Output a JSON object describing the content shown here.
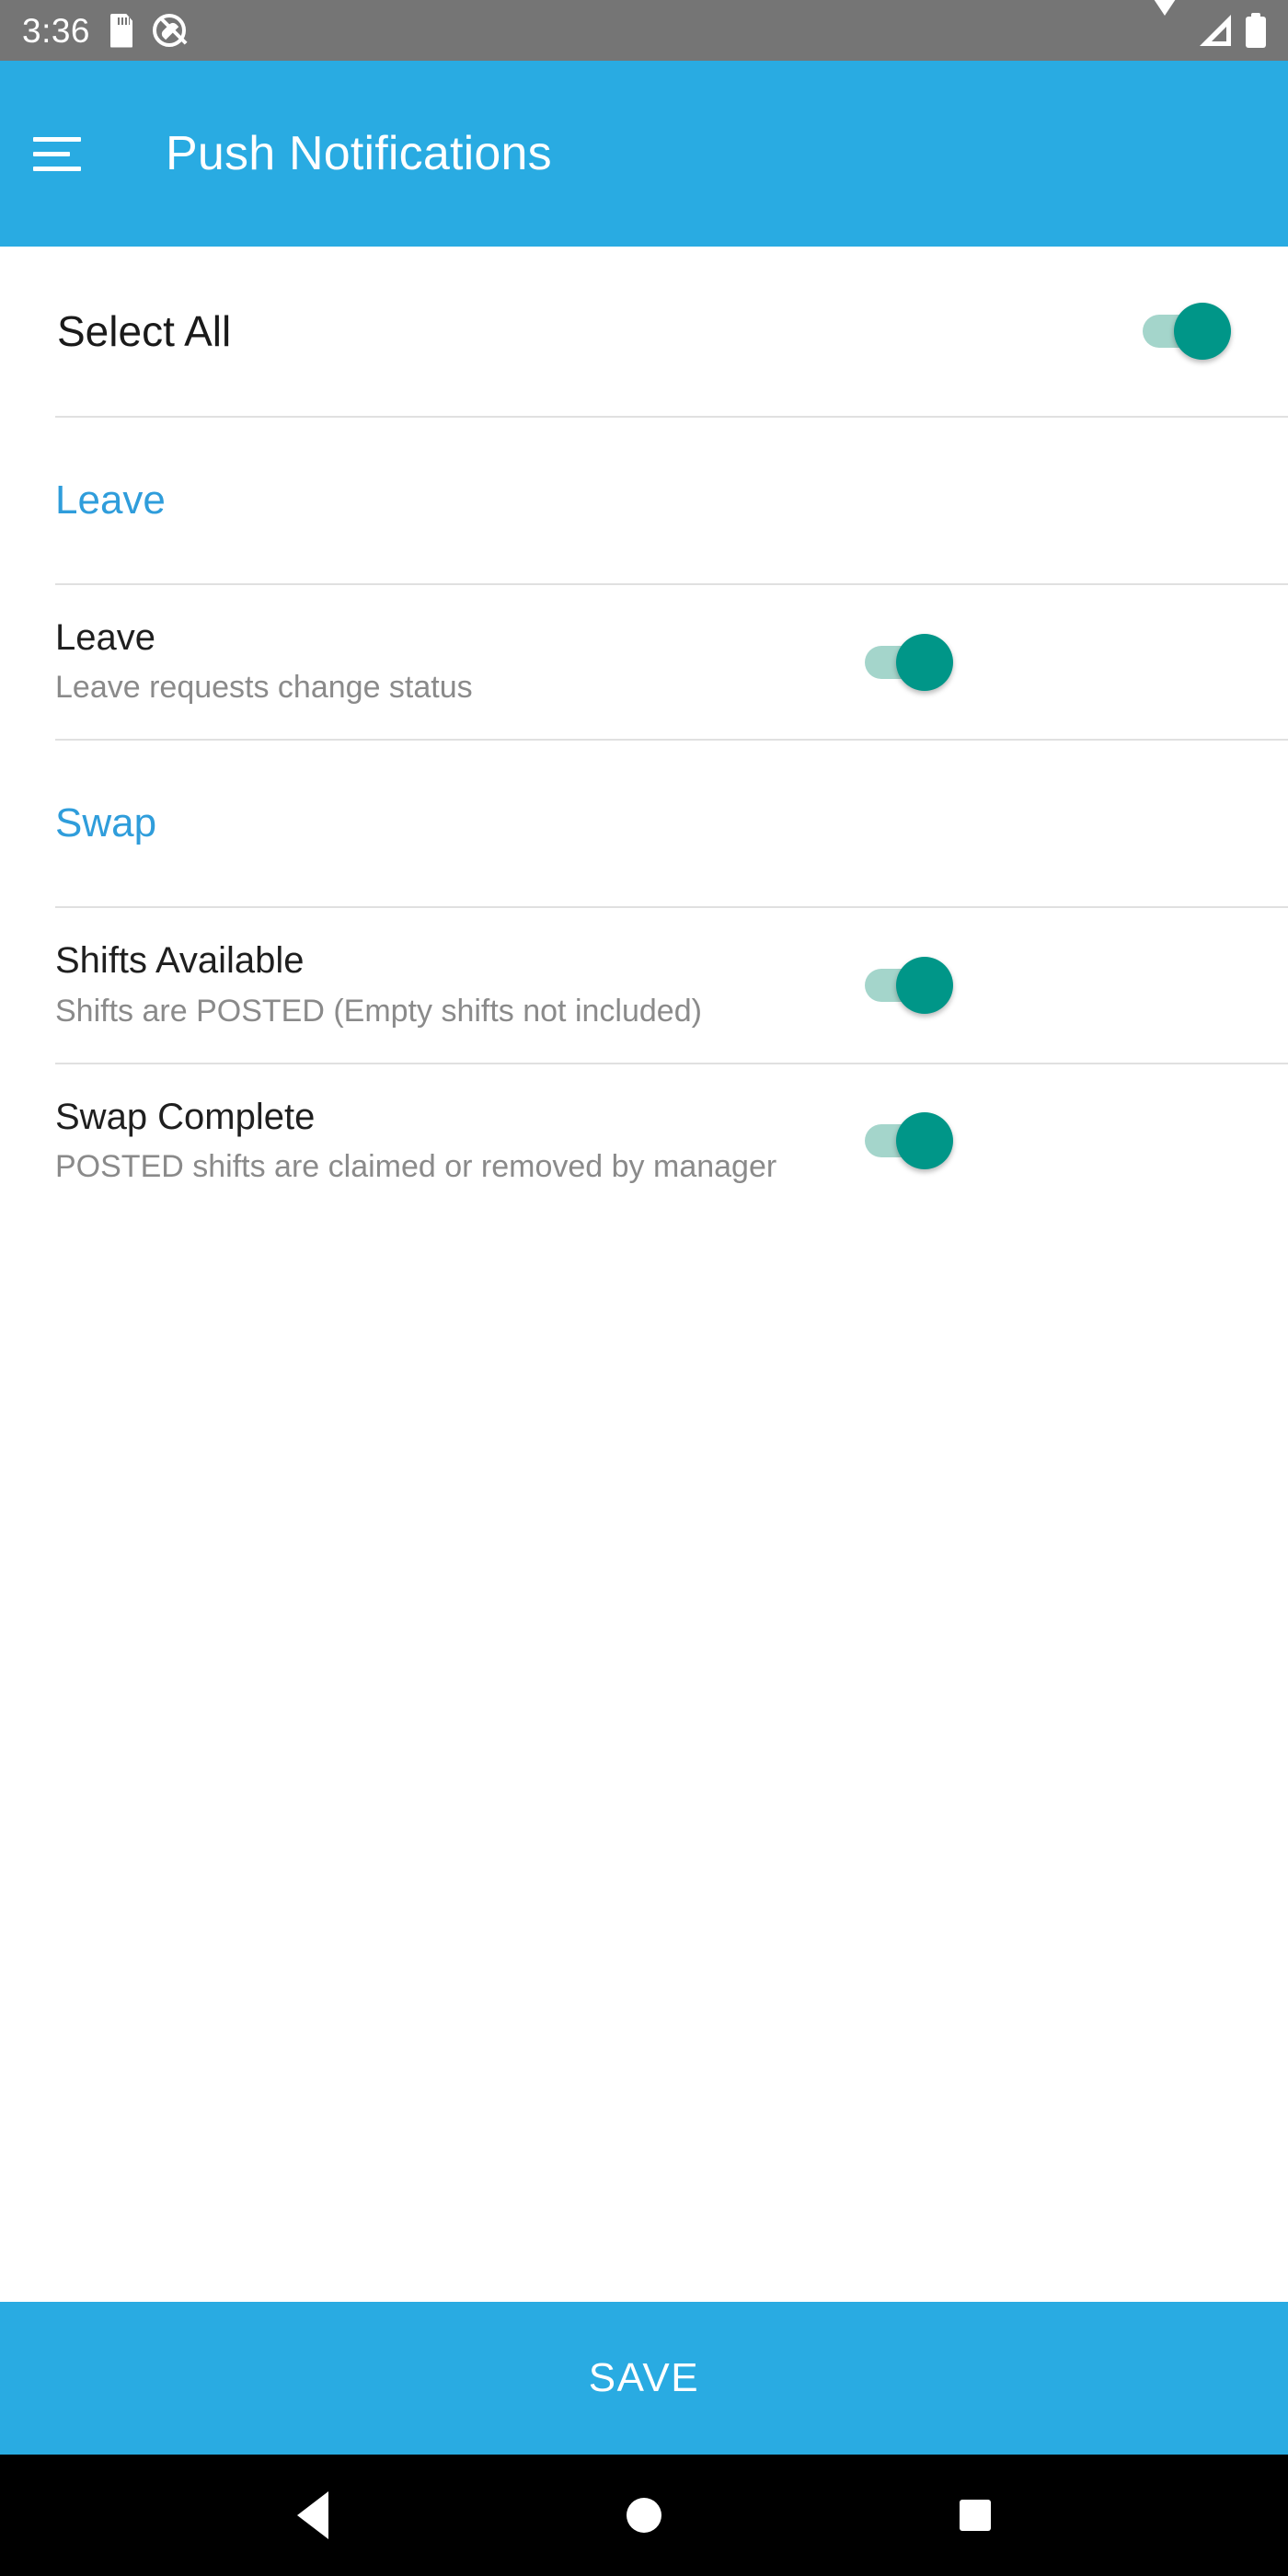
{
  "status_bar": {
    "time": "3:36",
    "icons_left": [
      "sdcard-icon",
      "do-not-disturb-icon"
    ],
    "icons_right": [
      "wifi-icon",
      "cellular-signal-icon",
      "battery-icon"
    ],
    "background_color": "#757575"
  },
  "app_bar": {
    "menu_icon": "hamburger-menu-icon",
    "title": "Push Notifications",
    "background_color": "#29abe2",
    "text_color": "#ffffff"
  },
  "select_all": {
    "label": "Select All",
    "toggle_state": "on"
  },
  "sections": [
    {
      "header": "Leave",
      "items": [
        {
          "title": "Leave",
          "subtitle": "Leave requests change status",
          "toggle_state": "on"
        }
      ]
    },
    {
      "header": "Swap",
      "items": [
        {
          "title": "Shifts Available",
          "subtitle": "Shifts are POSTED (Empty shifts not included)",
          "toggle_state": "on"
        },
        {
          "title": "Swap Complete",
          "subtitle": "POSTED shifts are claimed or removed by manager",
          "toggle_state": "on"
        }
      ]
    }
  ],
  "save_button": {
    "label": "SAVE",
    "background_color": "#29abe2"
  },
  "nav_bar": {
    "back": "back-triangle-icon",
    "home": "home-circle-icon",
    "recents": "recents-square-icon",
    "background_color": "#000000"
  },
  "colors": {
    "accent_blue": "#29abe2",
    "section_header_blue": "#2f9ddb",
    "toggle_thumb": "#009688",
    "toggle_track": "#a4d5cb",
    "subtitle_gray": "#8a8a8a",
    "divider": "#e0e0e0"
  }
}
